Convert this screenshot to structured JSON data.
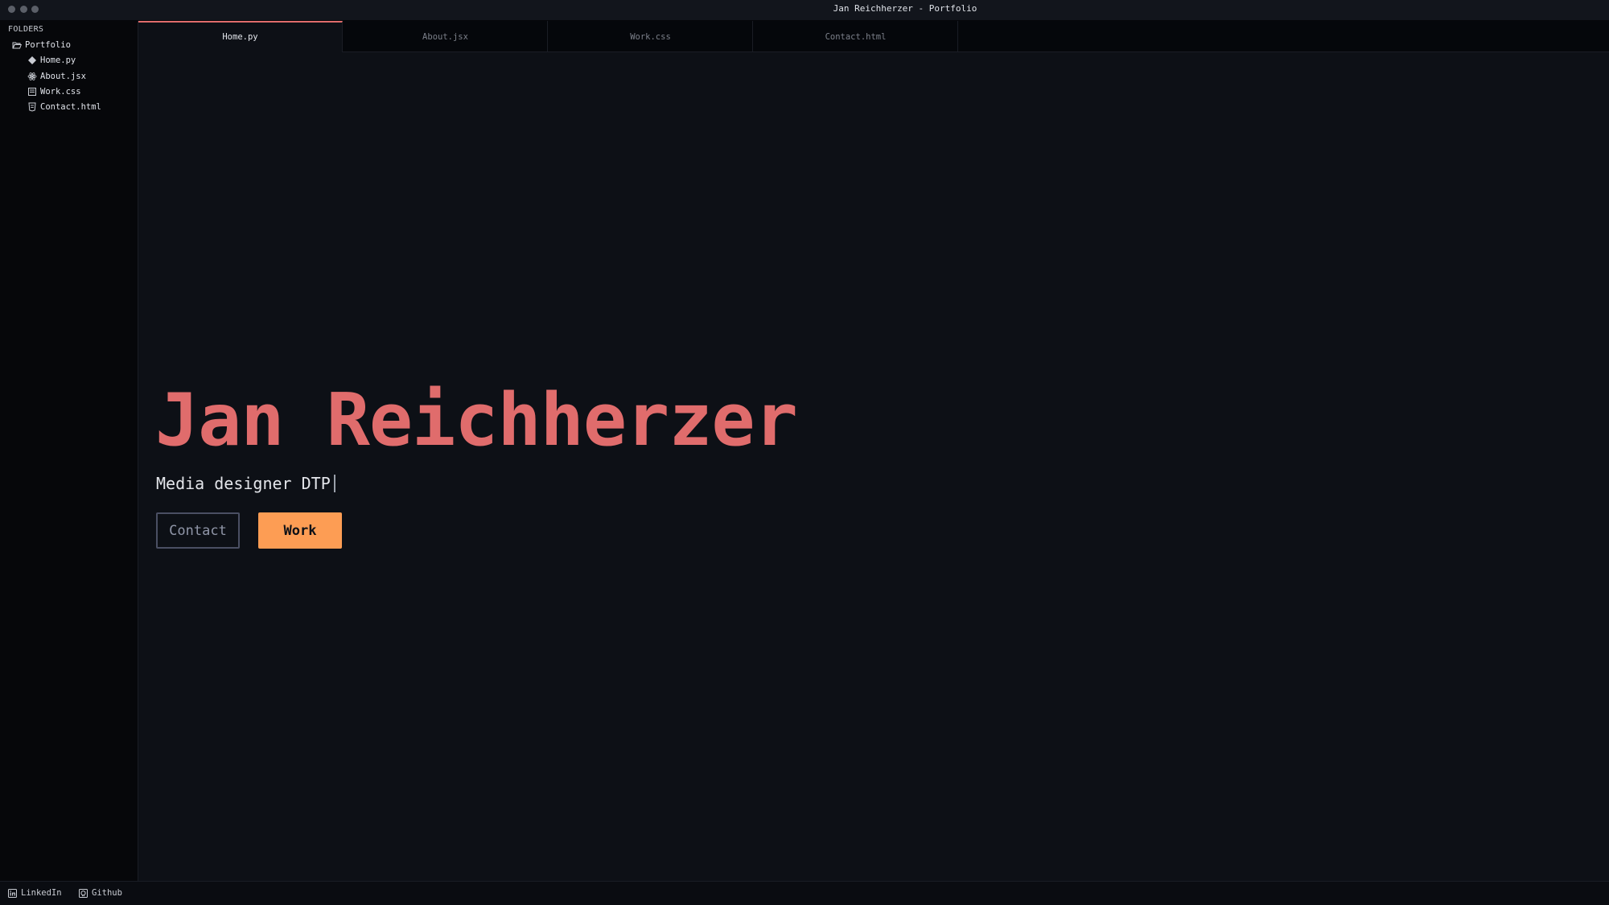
{
  "window": {
    "title": "Jan Reichherzer - Portfolio"
  },
  "sidebar": {
    "heading": "FOLDERS",
    "folder": {
      "label": "Portfolio",
      "icon": "folder-open-icon"
    },
    "files": [
      {
        "label": "Home.py",
        "icon": "python-icon"
      },
      {
        "label": "About.jsx",
        "icon": "react-icon"
      },
      {
        "label": "Work.css",
        "icon": "css-icon"
      },
      {
        "label": "Contact.html",
        "icon": "html-icon"
      }
    ]
  },
  "tabs": [
    {
      "label": "Home.py",
      "active": true
    },
    {
      "label": "About.jsx",
      "active": false
    },
    {
      "label": "Work.css",
      "active": false
    },
    {
      "label": "Contact.html",
      "active": false
    }
  ],
  "hero": {
    "name": "Jan Reichherzer",
    "subtitle": "Media designer DTP",
    "contact_label": "Contact",
    "work_label": "Work"
  },
  "statusbar": {
    "linkedin_label": "LinkedIn",
    "github_label": "Github"
  },
  "colors": {
    "accent": "#e06c6c",
    "button_primary": "#fd9d54",
    "background": "#0d1016",
    "sidebar": "#06070a"
  }
}
